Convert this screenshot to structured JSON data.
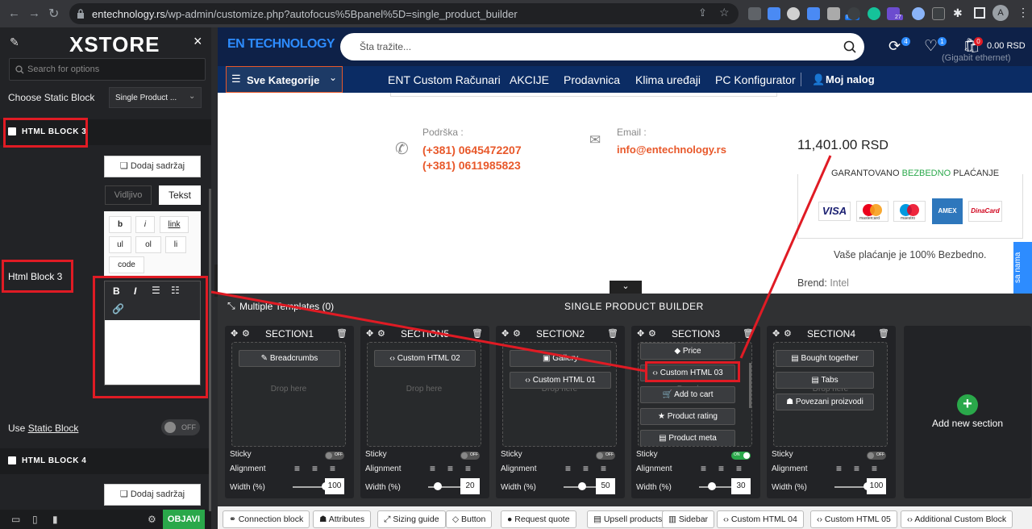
{
  "browser": {
    "url_domain": "entechnology.rs",
    "url_path": "/wp-admin/customize.php?autofocus%5Bpanel%5D=single_product_builder",
    "avatar": "A",
    "ext_badge_new": "New",
    "ext_badge_27": "27"
  },
  "panel": {
    "logo": "XSTORE",
    "close": "×",
    "search_placeholder": "Search for options",
    "choose_label": "Choose Static Block",
    "choose_value": "Single Product ...",
    "block3_title": "HTML BLOCK 3",
    "add_content": "Dodaj sadržaj",
    "tab_visual": "Vidljivo",
    "tab_text": "Tekst",
    "quicktags": [
      "b",
      "i",
      "link",
      "ul",
      "ol",
      "li",
      "code"
    ],
    "html_block_label": "Html Block 3",
    "use_static": "Use ",
    "use_static_link": "Static Block",
    "toggle_off": "OFF",
    "block4_title": "HTML BLOCK 4",
    "publish": "OBJAVI"
  },
  "site": {
    "logo": "EN TECHNOLOGY",
    "search_placeholder": "Šta tražite...",
    "compare_count": "4",
    "wish_count": "1",
    "cart_count": "0",
    "cart_total": "0.00 RSD",
    "behind_text": "(Gigabit ethernet)",
    "categories": "Sve Kategorije",
    "nav": [
      "ENT Custom Računari",
      "AKCIJE",
      "Prodavnica",
      "Klima uređaji",
      "PC Konfigurator"
    ],
    "account": "Moj nalog",
    "support_label": "Podrška :",
    "phone1": "(+381) 0645472207",
    "phone2": "(+381) 0611985823",
    "email_label": "Email :",
    "email": "info@entechnology.rs",
    "price": "11,401.00",
    "currency": "RSD",
    "guarantee_a": "GARANTOVANO ",
    "guarantee_b": "BEZBEDNO",
    "guarantee_c": " PLAĆANJE",
    "cards": [
      "VISA",
      "mastercard",
      "maestro",
      "AMEX",
      "DinaCard"
    ],
    "safe": "Vaše plaćanje je 100% Bezbedno.",
    "brand_label": "Brend:",
    "brand": "Intel",
    "side_tab": "sa nama"
  },
  "builder": {
    "templates": "Multiple Templates (0)",
    "title": "SINGLE PRODUCT BUILDER",
    "add_section": "Add new section",
    "drop_here": "Drop here",
    "sticky": "Sticky",
    "alignment": "Alignment",
    "width": "Width (%)",
    "off": "OFF",
    "on": "ON",
    "sections": [
      {
        "name": "SECTION1",
        "items": [
          "Breadcrumbs"
        ],
        "width": "100",
        "sticky": "OFF"
      },
      {
        "name": "SECTION5",
        "items": [
          "Custom HTML 02"
        ],
        "width": "20",
        "sticky": "OFF"
      },
      {
        "name": "SECTION2",
        "items": [
          "Gallery",
          "Custom HTML 01"
        ],
        "width": "50",
        "sticky": "OFF"
      },
      {
        "name": "SECTION3",
        "items": [
          "Price",
          "Custom HTML 03",
          "Add to cart",
          "Product rating",
          "Product meta"
        ],
        "width": "30",
        "sticky": "ON"
      },
      {
        "name": "SECTION4",
        "items": [
          "Bought together",
          "Tabs",
          "Povezani proizvodi"
        ],
        "width": "100",
        "sticky": "OFF"
      }
    ],
    "tabs": [
      "Connection block",
      "Attributes",
      "Sizing guide",
      "Button",
      "Request quote",
      "Upsell products",
      "Sidebar",
      "Custom HTML 04",
      "Custom HTML 05",
      "Additional Custom Block"
    ]
  },
  "colors": {
    "accent_red": "#e01b24",
    "orange": "#e8582a",
    "navy": "#0b2c64",
    "green": "#2aa84a"
  }
}
